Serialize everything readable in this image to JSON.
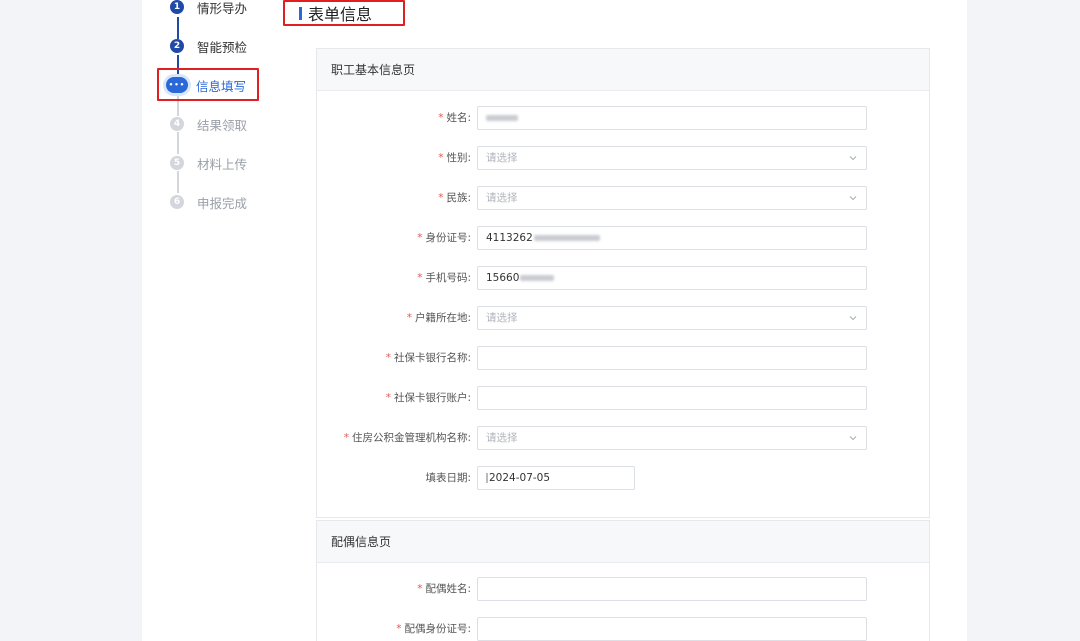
{
  "page_title": "表单信息",
  "steps": [
    {
      "num": "1",
      "label": "情形导办",
      "state": "done"
    },
    {
      "num": "2",
      "label": "智能预检",
      "state": "done"
    },
    {
      "num": "•••",
      "label": "信息填写",
      "state": "active"
    },
    {
      "num": "4",
      "label": "结果领取",
      "state": "todo"
    },
    {
      "num": "5",
      "label": "材料上传",
      "state": "todo"
    },
    {
      "num": "6",
      "label": "申报完成",
      "state": "todo"
    }
  ],
  "section_basic": {
    "title": "职工基本信息页",
    "fields": {
      "name": {
        "label": "姓名:",
        "value": ""
      },
      "gender": {
        "label": "性别:",
        "placeholder": "请选择"
      },
      "ethnicity": {
        "label": "民族:",
        "placeholder": "请选择"
      },
      "id_number": {
        "label": "身份证号:",
        "value": "4113262"
      },
      "phone": {
        "label": "手机号码:",
        "value": "15660"
      },
      "household": {
        "label": "户籍所在地:",
        "placeholder": "请选择"
      },
      "bank_name": {
        "label": "社保卡银行名称:",
        "value": ""
      },
      "bank_account": {
        "label": "社保卡银行账户:",
        "value": ""
      },
      "fund_org": {
        "label": "住房公积金管理机构名称:",
        "placeholder": "请选择"
      },
      "fill_date": {
        "label": "填表日期:",
        "value": "2024-07-05"
      }
    }
  },
  "section_spouse": {
    "title": "配偶信息页",
    "fields": {
      "spouse_name": {
        "label": "配偶姓名:",
        "value": ""
      },
      "spouse_id": {
        "label": "配偶身份证号:",
        "value": ""
      }
    }
  },
  "required_mark": "*",
  "colors": {
    "accent": "#2a68d8",
    "done": "#1f4aa8",
    "required": "#e35a52",
    "highlight": "#e02020"
  }
}
